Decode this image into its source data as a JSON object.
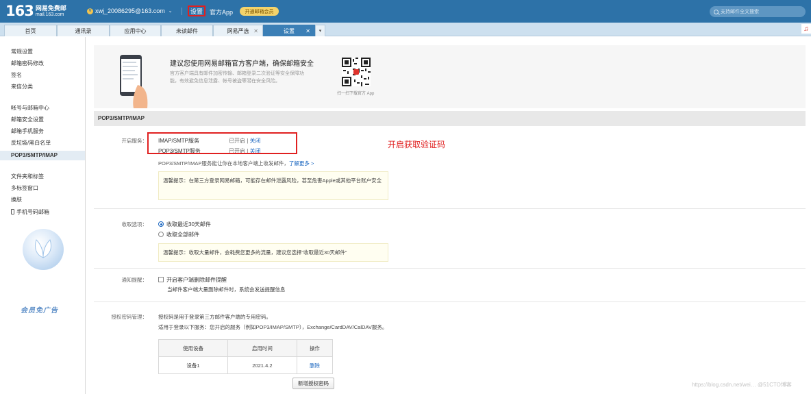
{
  "header": {
    "logo_number": "163",
    "logo_line1": "网易免费邮",
    "logo_line2": "mail.163.com",
    "account_badge": "V",
    "account": "xwj_20086295@163.com",
    "settings_link": "设置",
    "app_link": "官方App",
    "vip_button": "开通邮箱会员",
    "search_placeholder": "支持邮件全文搜索"
  },
  "tabs": [
    {
      "label": "首页"
    },
    {
      "label": "通讯录"
    },
    {
      "label": "应用中心"
    },
    {
      "label": "未读邮件"
    },
    {
      "label": "网易严选",
      "closable": true
    },
    {
      "label": "设置",
      "closable": true,
      "active": true
    }
  ],
  "sidebar": {
    "items": [
      "常规设置",
      "邮箱密码修改",
      "签名",
      "来信分类",
      "帐号与邮箱中心",
      "邮箱安全设置",
      "邮箱手机服务",
      "反垃圾/黑白名单",
      "POP3/SMTP/IMAP",
      "文件夹和标签",
      "多标签窗口",
      "换肤",
      "手机号码邮箱"
    ],
    "active_index": 8,
    "ad_text": "会员免广告"
  },
  "promo": {
    "title": "建议您使用网易邮箱官方客户端，确保邮箱安全",
    "desc": "官方客户端具有邮件加密传输、邮箱登录二次验证等安全保障功能，有效避免信息泄露、帐号被盗等潜在安全风险。",
    "qr_caption": "扫一扫下载官方 App"
  },
  "section_title": "POP3/SMTP/IMAP",
  "services": {
    "label": "开启服务：",
    "rows": [
      {
        "name": "IMAP/SMTP服务",
        "status": "已开启",
        "sep": " | ",
        "action": "关闭"
      },
      {
        "name": "POP3/SMTP服务",
        "status": "已开启",
        "sep": " | ",
        "action": "关闭"
      }
    ],
    "annotation": "开启获取验证码",
    "info": "POP3/SMTP/IMAP服务能让你在本地客户端上收发邮件，",
    "learn_more": "了解更多 >",
    "tip": "温馨提示：在第三方登录网易邮箱，可能存在邮件泄露风险，甚至危害Apple或其他平台账户安全"
  },
  "receive": {
    "label": "收取选项：",
    "options": [
      "收取最近30天邮件",
      "收取全部邮件"
    ],
    "selected": 0,
    "tip": "温馨提示：收取大量邮件，会耗费您更多的流量，建议您选择“收取最近30天邮件”"
  },
  "notify": {
    "label": "通知提醒：",
    "checkbox": "开启客户端删除邮件提醒",
    "checked": false,
    "hint": "当邮件客户端大量删除邮件时，系统会发送提醒信息"
  },
  "auth": {
    "label": "授权密码管理：",
    "line1": "授权码是用于登录第三方邮件客户端的专用密码。",
    "line2": "适用于登录以下服务：您开启的服务（例如POP3/IMAP/SMTP），Exchange/CardDAV/CalDAV服务。",
    "table_headers": [
      "使用设备",
      "启用时间",
      "操作"
    ],
    "rows": [
      {
        "device": "设备1",
        "time": "2021.4.2",
        "action": "删除"
      }
    ],
    "new_button": "新增授权密码"
  },
  "watermark": "https://blog.csdn.net/wei…  @51CTO博客",
  "colors": {
    "header_bg": "#2d72a8",
    "active_tab": "#3b7fb6",
    "link": "#1b67c0",
    "highlight": "#e02020"
  }
}
